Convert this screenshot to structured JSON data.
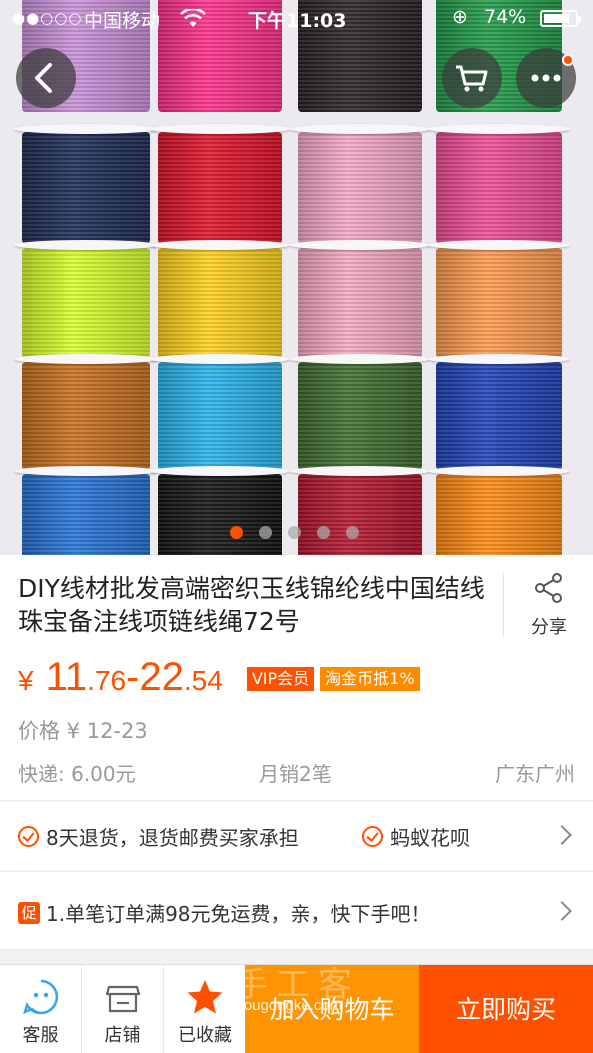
{
  "status_bar": {
    "signal": "●●○○○",
    "carrier": "中国移动",
    "time": "下午11:03",
    "battery": "74%"
  },
  "hero": {
    "spool_colors": [
      [
        "#c890d8",
        "#ff2f8a",
        "#2a2226",
        "#1f9a46"
      ],
      [
        "#1d2d55",
        "#e0142a",
        "#f5a8c8",
        "#f04d95"
      ],
      [
        "#d8ff2a",
        "#ffd21a",
        "#f7a9c1",
        "#ff9b4e"
      ],
      [
        "#c8701e",
        "#28b4ec",
        "#3f6d2f",
        "#1f43b8"
      ],
      [
        "#2673d6",
        "#141414",
        "#b3162e",
        "#ff8a12"
      ]
    ],
    "image_dots": 5,
    "active_dot": 0
  },
  "product": {
    "title": "DIY线材批发高端密织玉线锦纶线中国结线珠宝备注线项链线绳72号",
    "share_label": "分享",
    "price_symbol": "¥",
    "price_low_int": "11",
    "price_low_dec": ".76",
    "price_sep": "-",
    "price_high_int": "22",
    "price_high_dec": ".54",
    "badge_vip": "VIP会员",
    "badge_coin": "淘金币抵1%",
    "original_price": "价格 ¥ 12-23",
    "shipping": "快递: 6.00元",
    "monthly_sales": "月销2笔",
    "location": "广东广州"
  },
  "services": {
    "return_policy": "8天退货，退货邮费买家承担",
    "huabei": "蚂蚁花呗"
  },
  "promo": {
    "tag": "促",
    "text": "1.单笔订单满98元免运费，亲，快下手吧！"
  },
  "bottom_bar": {
    "service_label": "客服",
    "shop_label": "店铺",
    "favorite_label": "已收藏",
    "add_to_cart": "加入购物车",
    "buy_now": "立即购买",
    "watermark_cn": "手工客",
    "watermark": "shougongke.com"
  },
  "colors": {
    "accent": "#ff5000",
    "cart_button": "#ff9402"
  }
}
